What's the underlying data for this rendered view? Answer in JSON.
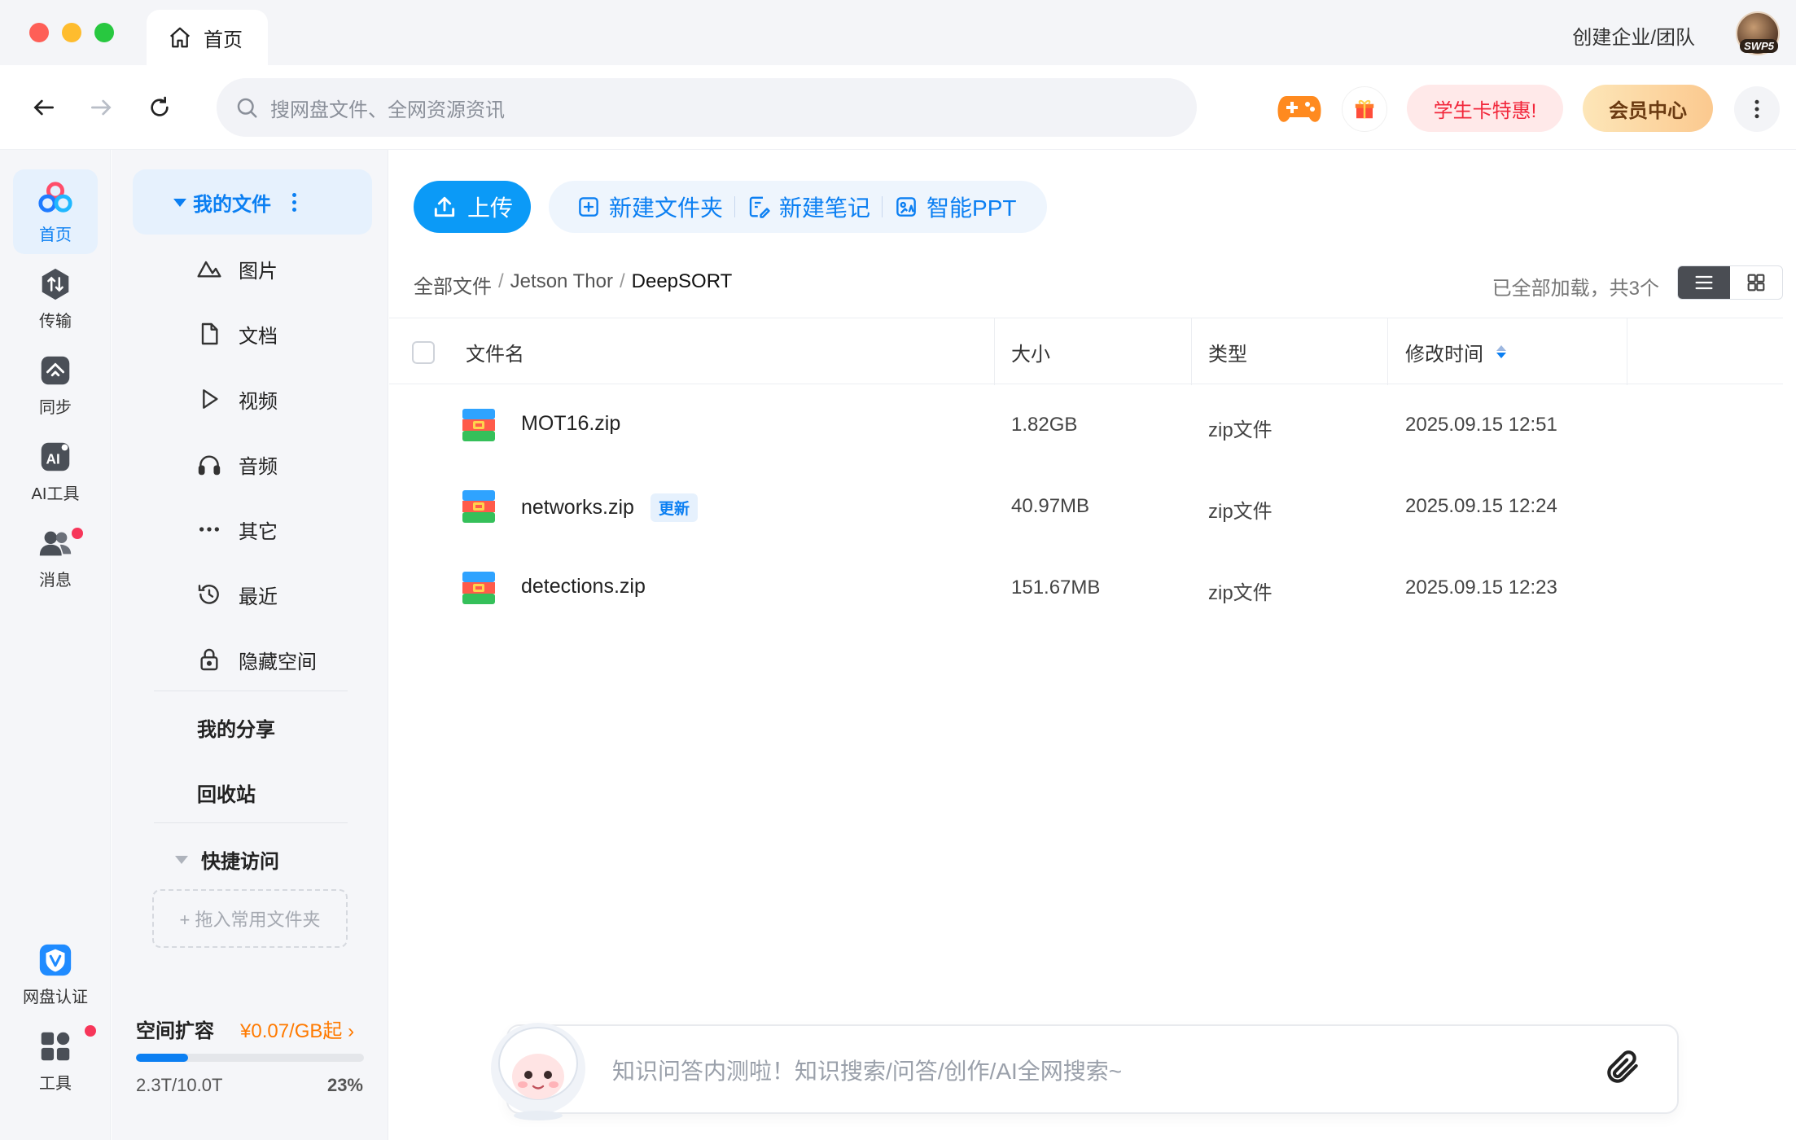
{
  "window": {
    "tab_label": "首页",
    "team_link": "创建企业/团队",
    "avatar_badge": "SWP5"
  },
  "navbar": {
    "search_placeholder": "搜网盘文件、全网资源资讯",
    "student_label": "学生卡特惠!",
    "vip_label": "会员中心"
  },
  "rail": {
    "home": "首页",
    "transfer": "传输",
    "sync": "同步",
    "ai_tools": "AI工具",
    "messages": "消息",
    "verify": "网盘认证",
    "tools": "工具"
  },
  "tree": {
    "my_files": "我的文件",
    "items": [
      "图片",
      "文档",
      "视频",
      "音频",
      "其它",
      "最近",
      "隐藏空间"
    ],
    "my_share": "我的分享",
    "recycle": "回收站",
    "quick_access": "快捷访问",
    "drop_hint": "+ 拖入常用文件夹",
    "storage_title": "空间扩容",
    "storage_price": "¥0.07/GB起 ›",
    "storage_used": "2.3T/10.0T",
    "storage_pct": "23%",
    "storage_fraction": 0.23
  },
  "main": {
    "upload": "上传",
    "new_folder": "新建文件夹",
    "new_note": "新建笔记",
    "smart_ppt": "智能PPT",
    "breadcrumb": [
      "全部文件",
      "Jetson Thor",
      "DeepSORT"
    ],
    "loaded_text": "已全部加载，共3个",
    "columns": {
      "name": "文件名",
      "size": "大小",
      "type": "类型",
      "modified": "修改时间"
    },
    "files": [
      {
        "name": "MOT16.zip",
        "badge": "",
        "size": "1.82GB",
        "type": "zip文件",
        "modified": "2025.09.15 12:51"
      },
      {
        "name": "networks.zip",
        "badge": "更新",
        "size": "40.97MB",
        "type": "zip文件",
        "modified": "2025.09.15 12:24"
      },
      {
        "name": "detections.zip",
        "badge": "",
        "size": "151.67MB",
        "type": "zip文件",
        "modified": "2025.09.15 12:23"
      }
    ]
  },
  "ai_bar": {
    "placeholder": "知识问答内测啦！知识搜索/问答/创作/AI全网搜索~"
  },
  "colors": {
    "accent": "#0b7ff2",
    "upload": "#0b9af7",
    "student": "#f2273b",
    "price": "#ff7a00"
  }
}
